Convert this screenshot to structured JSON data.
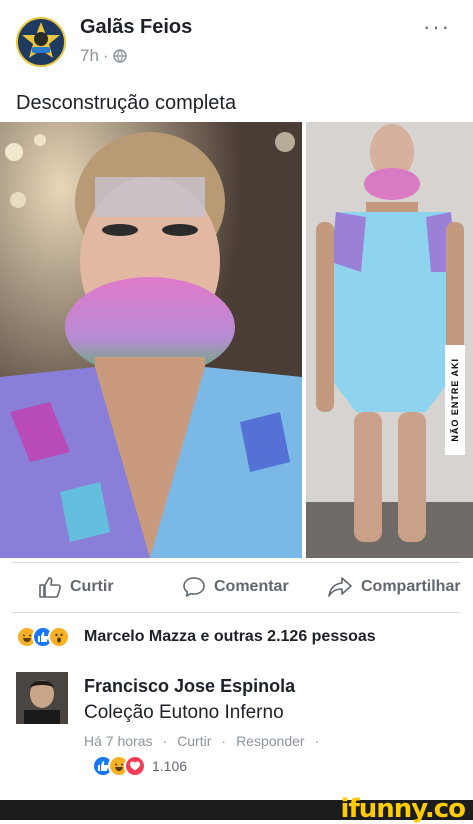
{
  "post": {
    "page_name": "Galãs Feios",
    "time": "7h",
    "separator": "·",
    "text": "Desconstrução completa",
    "more": "···"
  },
  "photos": {
    "watermark": "NÃO ENTRE AKI"
  },
  "actions": {
    "like": "Curtir",
    "comment": "Comentar",
    "share": "Compartilhar"
  },
  "reactions": {
    "summary": "Marcelo Mazza e outras 2.126 pessoas"
  },
  "comment": {
    "author": "Francisco Jose Espinola",
    "text": "Coleção Eutono Inferno",
    "time": "Há 7 horas",
    "like": "Curtir",
    "reply": "Responder",
    "sep": "·",
    "reaction_count": "1.106"
  },
  "footer": {
    "brand": "ifunny.co"
  },
  "colors": {
    "like_blue": "#1877f2",
    "haha_yellow": "#f7b125",
    "love_red": "#f33e58",
    "ifunny_yellow": "#ffcc00"
  }
}
